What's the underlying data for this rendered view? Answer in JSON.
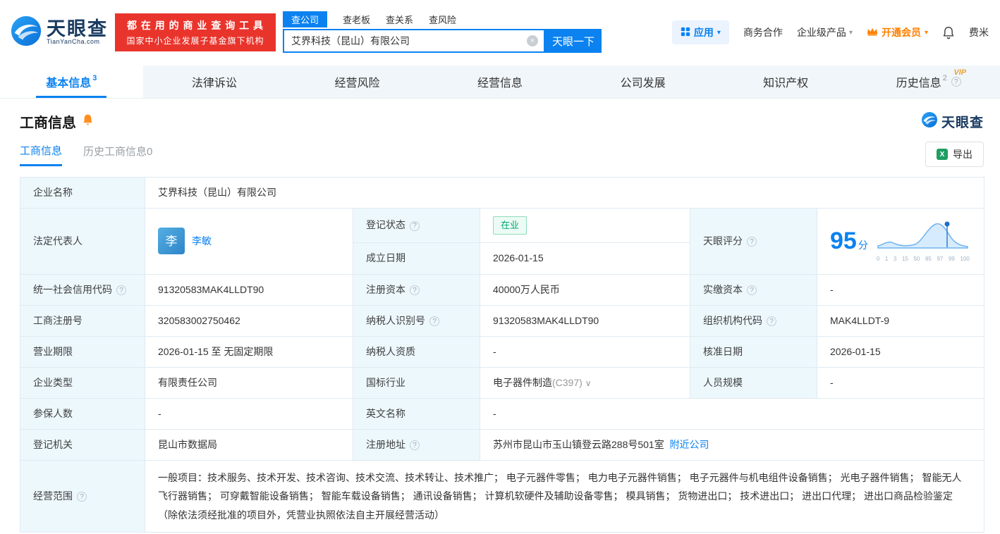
{
  "colors": {
    "brand_blue": "#0b82f0",
    "banner_red": "#e9342c",
    "status_green": "#00a972",
    "vip_orange": "#ff8000",
    "label_bg": "#edf8fd"
  },
  "icons": {
    "help": "?",
    "caret": "▾",
    "chevron": "∨",
    "clear": "×",
    "excel": "X"
  },
  "header": {
    "logo": {
      "title": "天眼查",
      "domain": "TianYanCha.com"
    },
    "banner": {
      "line1": "都 在 用 的 商 业 查 询 工 具",
      "line2": "国家中小企业发展子基金旗下机构"
    },
    "search": {
      "tabs": [
        {
          "label": "查公司"
        },
        {
          "label": "查老板"
        },
        {
          "label": "查关系"
        },
        {
          "label": "查风险"
        }
      ],
      "value": "艾界科技（昆山）有限公司",
      "button": "天眼一下"
    },
    "nav": {
      "app": "应用",
      "coop": "商务合作",
      "enterprise": "企业级产品",
      "vip": "开通会员",
      "user": "费米"
    }
  },
  "tabs": [
    {
      "label": "基本信息",
      "count": "3"
    },
    {
      "label": "法律诉讼"
    },
    {
      "label": "经营风险"
    },
    {
      "label": "经营信息"
    },
    {
      "label": "公司发展"
    },
    {
      "label": "知识产权"
    },
    {
      "label": "历史信息",
      "count": "2",
      "vip": "VIP"
    }
  ],
  "section": {
    "title": "工商信息",
    "brand": "天眼查",
    "subtabs": [
      {
        "label": "工商信息"
      },
      {
        "label": "历史工商信息0"
      }
    ],
    "export_label": "导出"
  },
  "info": {
    "company_name_label": "企业名称",
    "company_name": "艾界科技（昆山）有限公司",
    "legal_rep_label": "法定代表人",
    "legal_rep_avatar": "李",
    "legal_rep_name": "李敏",
    "reg_status_label": "登记状态",
    "reg_status": "在业",
    "score_label": "天眼评分",
    "score": "95",
    "score_unit": "分",
    "score_axis": [
      "0",
      "1",
      "3",
      "15",
      "50",
      "85",
      "97",
      "99",
      "100"
    ],
    "establish_label": "成立日期",
    "establish_date": "2026-01-15",
    "credit_code_label": "统一社会信用代码",
    "credit_code": "91320583MAK4LLDT90",
    "reg_capital_label": "注册资本",
    "reg_capital": "40000万人民币",
    "paid_capital_label": "实缴资本",
    "paid_capital": "-",
    "reg_number_label": "工商注册号",
    "reg_number": "320583002750462",
    "taxpayer_id_label": "纳税人识别号",
    "taxpayer_id": "91320583MAK4LLDT90",
    "org_code_label": "组织机构代码",
    "org_code": "MAK4LLDT-9",
    "business_term_label": "营业期限",
    "business_term": "2026-01-15 至 无固定期限",
    "taxpayer_quality_label": "纳税人资质",
    "taxpayer_quality": "-",
    "approval_date_label": "核准日期",
    "approval_date": "2026-01-15",
    "company_type_label": "企业类型",
    "company_type": "有限责任公司",
    "industry_label": "国标行业",
    "industry": "电子器件制造",
    "industry_code": "(C397)",
    "staff_size_label": "人员规模",
    "staff_size": "-",
    "insured_label": "参保人数",
    "insured": "-",
    "english_name_label": "英文名称",
    "english_name": "-",
    "reg_authority_label": "登记机关",
    "reg_authority": "昆山市数据局",
    "reg_address_label": "注册地址",
    "reg_address": "苏州市昆山市玉山镇登云路288号501室",
    "nearby_link": "附近公司",
    "business_scope_label": "经营范围",
    "business_scope": "一般项目：技术服务、技术开发、技术咨询、技术交流、技术转让、技术推广； 电子元器件零售； 电力电子元器件销售； 电子元器件与机电组件设备销售； 光电子器件销售； 智能无人飞行器销售； 可穿戴智能设备销售； 智能车载设备销售； 通讯设备销售； 计算机软硬件及辅助设备零售； 模具销售； 货物进出口； 技术进出口； 进出口代理； 进出口商品检验鉴定（除依法须经批准的项目外，凭营业执照依法自主开展经营活动）"
  }
}
